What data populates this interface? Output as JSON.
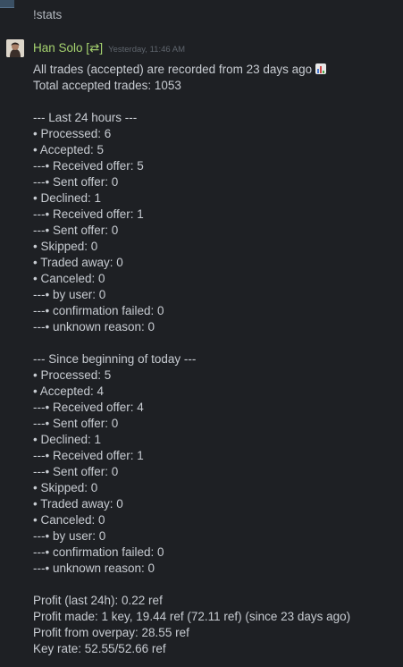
{
  "previous_message": {
    "text": "!stats"
  },
  "message": {
    "sender": "Han Solo [⇄]",
    "timestamp": "Yesterday, 11:46 AM",
    "lines": [
      "All trades (accepted) are recorded from 23 days ago",
      "Total accepted trades: 1053",
      "",
      "--- Last 24 hours ---",
      "• Processed: 6",
      "• Accepted: 5",
      "---• Received offer: 5",
      "---• Sent offer: 0",
      "• Declined: 1",
      "---• Received offer: 1",
      "---• Sent offer: 0",
      "• Skipped: 0",
      "• Traded away: 0",
      "• Canceled: 0",
      "---• by user: 0",
      "---• confirmation failed: 0",
      "---• unknown reason: 0",
      "",
      "--- Since beginning of today ---",
      "• Processed: 5",
      "• Accepted: 4",
      "---• Received offer: 4",
      "---• Sent offer: 0",
      "• Declined: 1",
      "---• Received offer: 1",
      "---• Sent offer: 0",
      "• Skipped: 0",
      "• Traded away: 0",
      "• Canceled: 0",
      "---• by user: 0",
      "---• confirmation failed: 0",
      "---• unknown reason: 0",
      "",
      "Profit (last 24h): 0.22 ref",
      "Profit made: 1 key, 19.44 ref (72.11 ref) (since 23 days ago)",
      "Profit from overpay: 28.55 ref",
      "Key rate: 52.55/52.66 ref"
    ],
    "emoji_icon": "bar-chart-emoji-icon"
  },
  "colors": {
    "background": "#1e2024",
    "sender_name": "#a6d36f",
    "timestamp": "#5f656d",
    "text": "#c8ccd2"
  }
}
